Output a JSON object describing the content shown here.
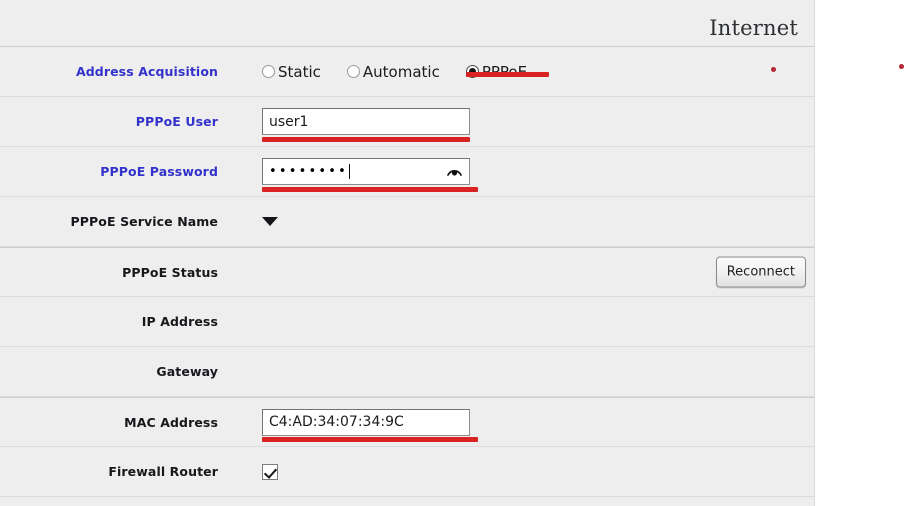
{
  "header": {
    "title": "Internet"
  },
  "rows": {
    "address_acquisition": {
      "label": "Address Acquisition",
      "options": [
        {
          "label": "Static",
          "selected": false
        },
        {
          "label": "Automatic",
          "selected": false
        },
        {
          "label": "PPPoE",
          "selected": true
        }
      ]
    },
    "pppoe_user": {
      "label": "PPPoE User",
      "value": "user1",
      "placeholder": ""
    },
    "pppoe_password": {
      "label": "PPPoE Password",
      "value": "••••••••",
      "masked_char_count": "8",
      "reveal_icon": "eye-icon"
    },
    "pppoe_service_name": {
      "label": "PPPoE Service Name",
      "dropdown_icon": "chevron-down-icon"
    },
    "pppoe_status": {
      "label": "PPPoE Status",
      "value": "",
      "button_label": "Reconnect"
    },
    "ip_address": {
      "label": "IP Address",
      "value": ""
    },
    "gateway": {
      "label": "Gateway",
      "value": ""
    },
    "mac_address": {
      "label": "MAC Address",
      "value": "C4:AD:34:07:34:9C"
    },
    "firewall_router": {
      "label": "Firewall Router",
      "checked": true
    }
  },
  "colors": {
    "label_blue": "#3333cc",
    "label_black": "#17171c",
    "annotation_red": "#d92323",
    "panel_background": "#eeeeee",
    "page_background": "#ffffff"
  }
}
